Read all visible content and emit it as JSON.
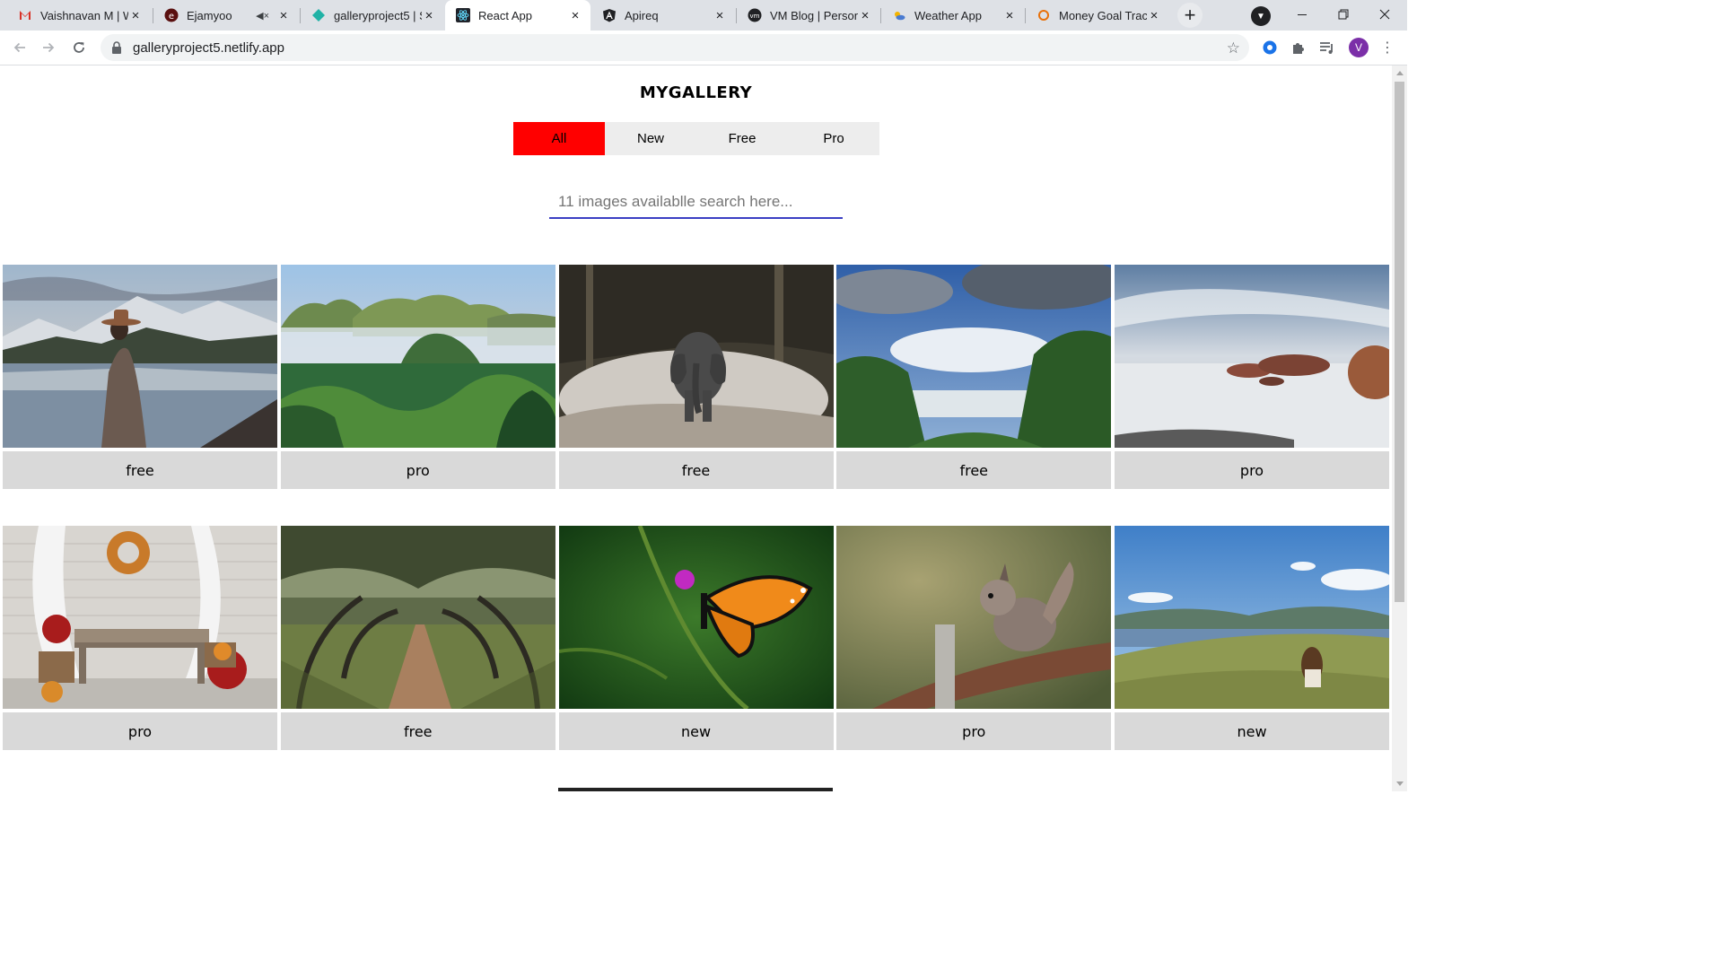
{
  "browser": {
    "tabs": [
      {
        "title": "Vaishnavan M | W",
        "icon": "gmail-m-icon",
        "close": "×"
      },
      {
        "title": "Ejamyoo",
        "icon": "ejamyoo-icon",
        "close": "×",
        "muted": true
      },
      {
        "title": "galleryproject5 | S",
        "icon": "netlify-icon",
        "close": "×"
      },
      {
        "title": "React App",
        "icon": "react-icon",
        "close": "×",
        "active": true
      },
      {
        "title": "Apireq",
        "icon": "angular-icon",
        "close": "×"
      },
      {
        "title": "VM Blog | Persona",
        "icon": "vm-icon",
        "close": "×"
      },
      {
        "title": "Weather App",
        "icon": "weather-icon",
        "close": "×"
      },
      {
        "title": "Money Goal Track",
        "icon": "money-icon",
        "close": "×"
      }
    ],
    "new_tab": "+",
    "url": "galleryproject5.netlify.app",
    "profile_initial": "V"
  },
  "app": {
    "title": "MYGALLERY",
    "filters": [
      {
        "label": "All",
        "active": true
      },
      {
        "label": "New",
        "active": false
      },
      {
        "label": "Free",
        "active": false
      },
      {
        "label": "Pro",
        "active": false
      }
    ],
    "search_placeholder": "11 images availablle search here...",
    "images": [
      {
        "scene": "woman-at-mountain-lake",
        "tag": "free"
      },
      {
        "scene": "green-valley-mountains",
        "tag": "pro"
      },
      {
        "scene": "elephant-on-path",
        "tag": "free"
      },
      {
        "scene": "waterfall-jungle-sky",
        "tag": "free"
      },
      {
        "scene": "rocky-beach",
        "tag": "pro"
      },
      {
        "scene": "porch-bench-autumn",
        "tag": "pro"
      },
      {
        "scene": "oak-tree-alley",
        "tag": "free"
      },
      {
        "scene": "monarch-butterfly",
        "tag": "new"
      },
      {
        "scene": "red-squirrel",
        "tag": "pro"
      },
      {
        "scene": "girl-on-hill-lake",
        "tag": "new"
      }
    ]
  },
  "colors": {
    "active_filter": "#ff0000",
    "search_underline": "#3b3fc4",
    "tag_background": "#d9d9d9"
  }
}
